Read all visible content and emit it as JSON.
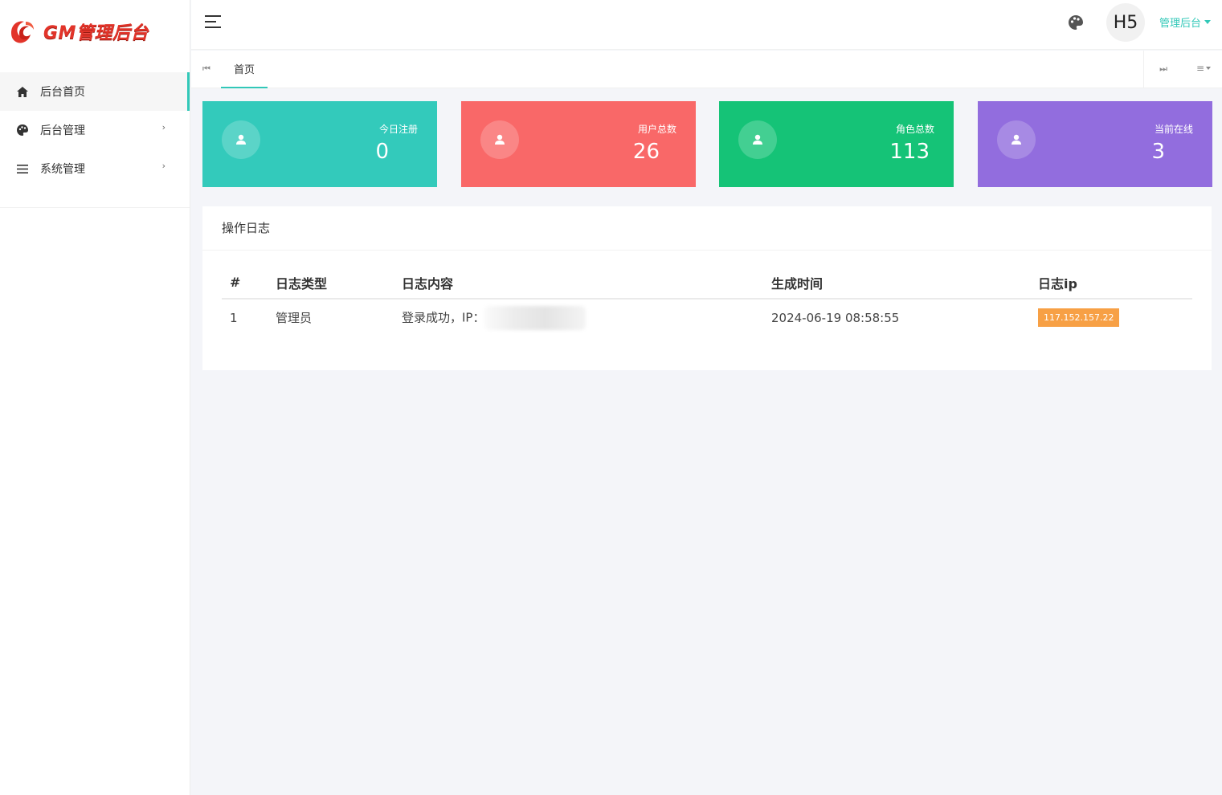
{
  "app": {
    "logo_text": "GM管理后台"
  },
  "sidebar": {
    "items": [
      {
        "label": "后台首页",
        "icon": "home-icon",
        "active": true
      },
      {
        "label": "后台管理",
        "icon": "palette-icon",
        "has_children": true
      },
      {
        "label": "系统管理",
        "icon": "menu-lines-icon",
        "has_children": true
      }
    ]
  },
  "header": {
    "avatar_text": "H5",
    "user_menu_label": "管理后台"
  },
  "tabs": {
    "home": "首页"
  },
  "stats": [
    {
      "label": "今日注册",
      "value": "0",
      "color": "#33cabb"
    },
    {
      "label": "用户总数",
      "value": "26",
      "color": "#f96868"
    },
    {
      "label": "角色总数",
      "value": "113",
      "color": "#15c377"
    },
    {
      "label": "当前在线",
      "value": "3",
      "color": "#926dde"
    }
  ],
  "log_panel": {
    "title": "操作日志",
    "columns": [
      "#",
      "日志类型",
      "日志内容",
      "生成时间",
      "日志ip"
    ],
    "rows": [
      {
        "id": "1",
        "type": "管理员",
        "content": "登录成功，IP：",
        "time": "2024-06-19 08:58:55",
        "ip": "117.152.157.22"
      }
    ]
  },
  "colors": {
    "accent": "#33cabb",
    "ip_badge": "#f7a045"
  }
}
